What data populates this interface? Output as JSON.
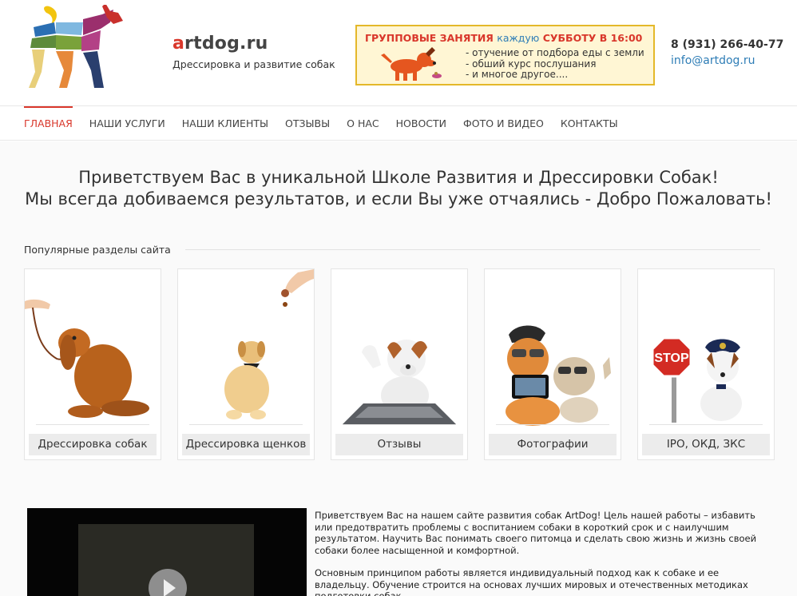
{
  "header": {
    "brand_first": "a",
    "brand_rest": "rtdog.ru",
    "tagline": "Дрессировка и развитие собак",
    "promo": {
      "title_start": "ГРУППОВЫЕ ЗАНЯТИЯ",
      "title_mid": "каждую",
      "title_end": "СУББОТУ В 16:00",
      "items": [
        "- отучение от подбора еды с земли",
        "- обший курс послушания",
        "- и многое другое...."
      ]
    },
    "phone": "8 (931) 266-40-77",
    "email": "info@artdog.ru"
  },
  "nav": {
    "items": [
      "ГЛАВНАЯ",
      "НАШИ УСЛУГИ",
      "НАШИ КЛИЕНТЫ",
      "ОТЗЫВЫ",
      "О НАС",
      "НОВОСТИ",
      "ФОТО И ВИДЕО",
      "КОНТАКТЫ"
    ],
    "active": "ГЛАВНАЯ"
  },
  "welcome": {
    "line1": "Приветствуем Вас в уникальной Школе Развития и Дрессировки Собак!",
    "line2": "Мы всегда добиваемся результатов, и если Вы уже отчаялись - Добро Пожаловать!"
  },
  "popular": {
    "title": "Популярные разделы сайта",
    "cards": [
      {
        "label": "Дрессировка собак",
        "icon": "spaniel-on-leash-image"
      },
      {
        "label": "Дрессировка щенков",
        "icon": "puppy-treat-image"
      },
      {
        "label": "Отзывы",
        "icon": "dog-keyboard-image"
      },
      {
        "label": "Фотографии",
        "icon": "dog-cat-selfie-image"
      },
      {
        "label": "IPO, ОКД, ЗКС",
        "icon": "police-dog-stop-sign-image"
      }
    ]
  },
  "about": {
    "p1": "Приветствуем Вас на нашем сайте развития собак ArtDog! Цель нашей работы – избавить или предотвратить проблемы с воспитанием собаки в короткий срок и с наилучшим результатом. Научить Вас понимать своего питомца и сделать свою жизнь и жизнь своей собаки более насыщенной и комфортной.",
    "p2": " Основным принципом работы является индивидуальный подход как к собаке и ее владельцу. Обучение строится на основах лучших мировых и отечественных методиках подготовки собак."
  },
  "colors": {
    "accent": "#d9372b",
    "link": "#2e7db6",
    "promo_border": "#e4b829",
    "promo_bg": "#fff6d4"
  }
}
